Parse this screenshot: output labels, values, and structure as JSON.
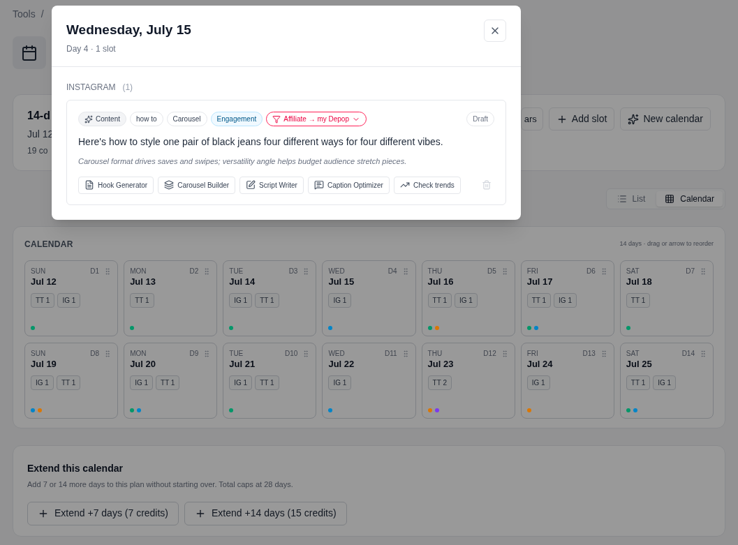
{
  "breadcrumb": [
    "Tools",
    "/"
  ],
  "header": {
    "title": "14-d",
    "dates": "Jul 12",
    "summary": "19 co",
    "buttons": [
      "ars",
      "Add slot",
      "New calendar"
    ]
  },
  "view_toggle": [
    {
      "label": "List",
      "selected": false
    },
    {
      "label": "Calendar",
      "selected": true
    }
  ],
  "calendar": {
    "title": "CALENDAR",
    "hint": "14 days · drag or arrow to reorder",
    "days": [
      {
        "weekday": "SUN",
        "index": "D1",
        "date": "Jul 12",
        "counts": [
          "TT 1",
          "IG 1"
        ],
        "dots": [
          {
            "color": "#059669"
          }
        ]
      },
      {
        "weekday": "MON",
        "index": "D2",
        "date": "Jul 13",
        "counts": [
          "TT 1"
        ],
        "dots": [
          {
            "color": "#059669"
          }
        ]
      },
      {
        "weekday": "TUE",
        "index": "D3",
        "date": "Jul 14",
        "counts": [
          "IG 1",
          "TT 1"
        ],
        "dots": [
          {
            "color": "#059669"
          }
        ]
      },
      {
        "weekday": "WED",
        "index": "D4",
        "date": "Jul 15",
        "counts": [
          "IG 1"
        ],
        "dots": [
          {
            "color": "#0284c7"
          }
        ]
      },
      {
        "weekday": "THU",
        "index": "D5",
        "date": "Jul 16",
        "counts": [
          "TT 1",
          "IG 1"
        ],
        "dots": [
          {
            "color": "#059669"
          },
          {
            "color": "#d97706"
          }
        ]
      },
      {
        "weekday": "FRI",
        "index": "D6",
        "date": "Jul 17",
        "counts": [
          "TT 1",
          "IG 1"
        ],
        "dots": [
          {
            "color": "#059669"
          },
          {
            "color": "#0284c7"
          }
        ]
      },
      {
        "weekday": "SAT",
        "index": "D7",
        "date": "Jul 18",
        "counts": [
          "TT 1"
        ],
        "dots": [
          {
            "color": "#059669"
          }
        ]
      },
      {
        "weekday": "SUN",
        "index": "D8",
        "date": "Jul 19",
        "counts": [
          "IG 1",
          "TT 1"
        ],
        "dots": [
          {
            "color": "#0284c7"
          },
          {
            "color": "#d97706"
          }
        ]
      },
      {
        "weekday": "MON",
        "index": "D9",
        "date": "Jul 20",
        "counts": [
          "IG 1",
          "TT 1"
        ],
        "dots": [
          {
            "color": "#059669"
          },
          {
            "color": "#0284c7"
          }
        ]
      },
      {
        "weekday": "TUE",
        "index": "D10",
        "date": "Jul 21",
        "counts": [
          "IG 1",
          "TT 1"
        ],
        "dots": [
          {
            "color": "#059669"
          }
        ]
      },
      {
        "weekday": "WED",
        "index": "D11",
        "date": "Jul 22",
        "counts": [
          "IG 1"
        ],
        "dots": [
          {
            "color": "#0284c7"
          }
        ]
      },
      {
        "weekday": "THU",
        "index": "D12",
        "date": "Jul 23",
        "counts": [
          "TT 2"
        ],
        "dots": [
          {
            "color": "#d97706"
          },
          {
            "color": "#7c3aed"
          }
        ]
      },
      {
        "weekday": "FRI",
        "index": "D13",
        "date": "Jul 24",
        "counts": [
          "IG 1"
        ],
        "dots": [
          {
            "color": "#d97706"
          }
        ]
      },
      {
        "weekday": "SAT",
        "index": "D14",
        "date": "Jul 25",
        "counts": [
          "TT 1",
          "IG 1"
        ],
        "dots": [
          {
            "color": "#059669"
          },
          {
            "color": "#0284c7"
          }
        ]
      }
    ]
  },
  "extend": {
    "title": "Extend this calendar",
    "description": "Add 7 or 14 more days to this plan without starting over. Total caps at 28 days.",
    "buttons": [
      "Extend +7 days (7 credits)",
      "Extend +14 days (15 credits)"
    ]
  },
  "modal": {
    "title": "Wednesday, July 15",
    "subtitle": "Day 4 · 1 slot",
    "section": {
      "label": "INSTAGRAM",
      "count": "(1)"
    },
    "slot": {
      "tags": [
        {
          "label": "Content",
          "kind": "content"
        },
        {
          "label": "how to",
          "kind": "plain"
        },
        {
          "label": "Carousel",
          "kind": "plain"
        },
        {
          "label": "Engagement",
          "kind": "goal"
        },
        {
          "label": "Affiliate → my Depop",
          "kind": "affiliate"
        }
      ],
      "status": "Draft",
      "text": "Here's how to style one pair of black jeans four different ways for four different vibes.",
      "rationale": "Carousel format drives saves and swipes; versatility angle helps budget audience stretch pieces.",
      "tools": [
        "Hook Generator",
        "Carousel Builder",
        "Script Writer",
        "Caption Optimizer",
        "Check trends"
      ]
    }
  }
}
